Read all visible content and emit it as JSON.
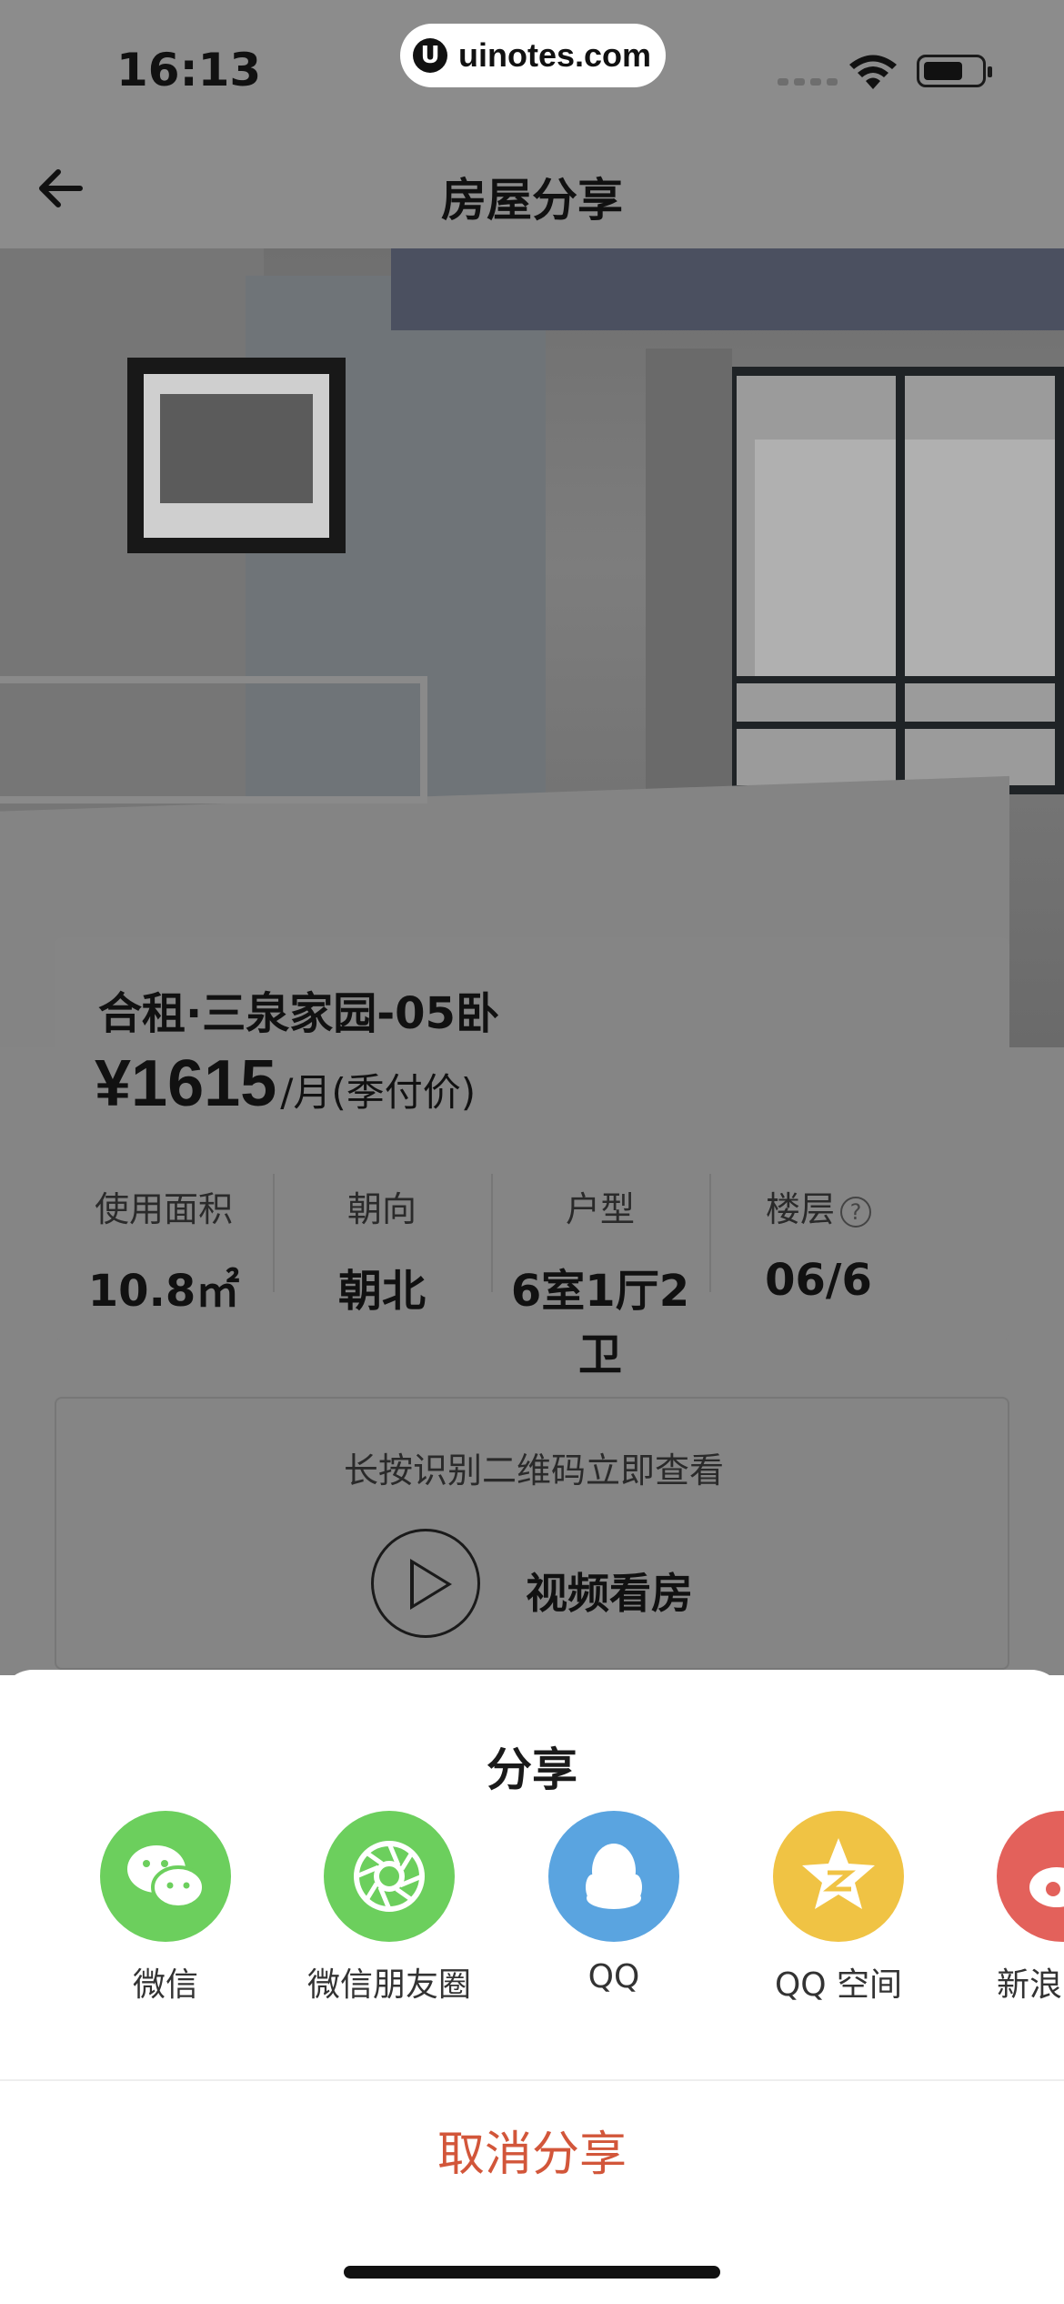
{
  "status_bar": {
    "time": "16:13",
    "url": "uinotes.com",
    "url_logo": "U"
  },
  "nav": {
    "title": "房屋分享",
    "back_icon": "arrow-left-icon"
  },
  "listing": {
    "title": "合租·三泉家园-05卧",
    "price": "¥1615",
    "price_unit": "/月(季付价)",
    "stats": [
      {
        "label": "使用面积",
        "value": "10.8㎡"
      },
      {
        "label": "朝向",
        "value": "朝北"
      },
      {
        "label": "户型",
        "value": "6室1厅2卫"
      },
      {
        "label": "楼层",
        "value": "06/6",
        "help": "?"
      }
    ]
  },
  "qr_section": {
    "hint": "长按识别二维码立即查看",
    "video_label": "视频看房"
  },
  "share_sheet": {
    "title": "分享",
    "items": [
      {
        "label": "微信",
        "icon": "wechat-icon",
        "color": "#6ccf5d"
      },
      {
        "label": "微信朋友圈",
        "icon": "moments-icon",
        "color": "#6ccf5d"
      },
      {
        "label": "QQ",
        "icon": "qq-icon",
        "color": "#5aa4e0"
      },
      {
        "label": "QQ 空间",
        "icon": "qzone-icon",
        "color": "#f0c344"
      },
      {
        "label": "新浪",
        "icon": "weibo-icon",
        "color": "#e3615b"
      }
    ],
    "cancel_label": "取消分享",
    "cancel_color": "#d2563a"
  }
}
